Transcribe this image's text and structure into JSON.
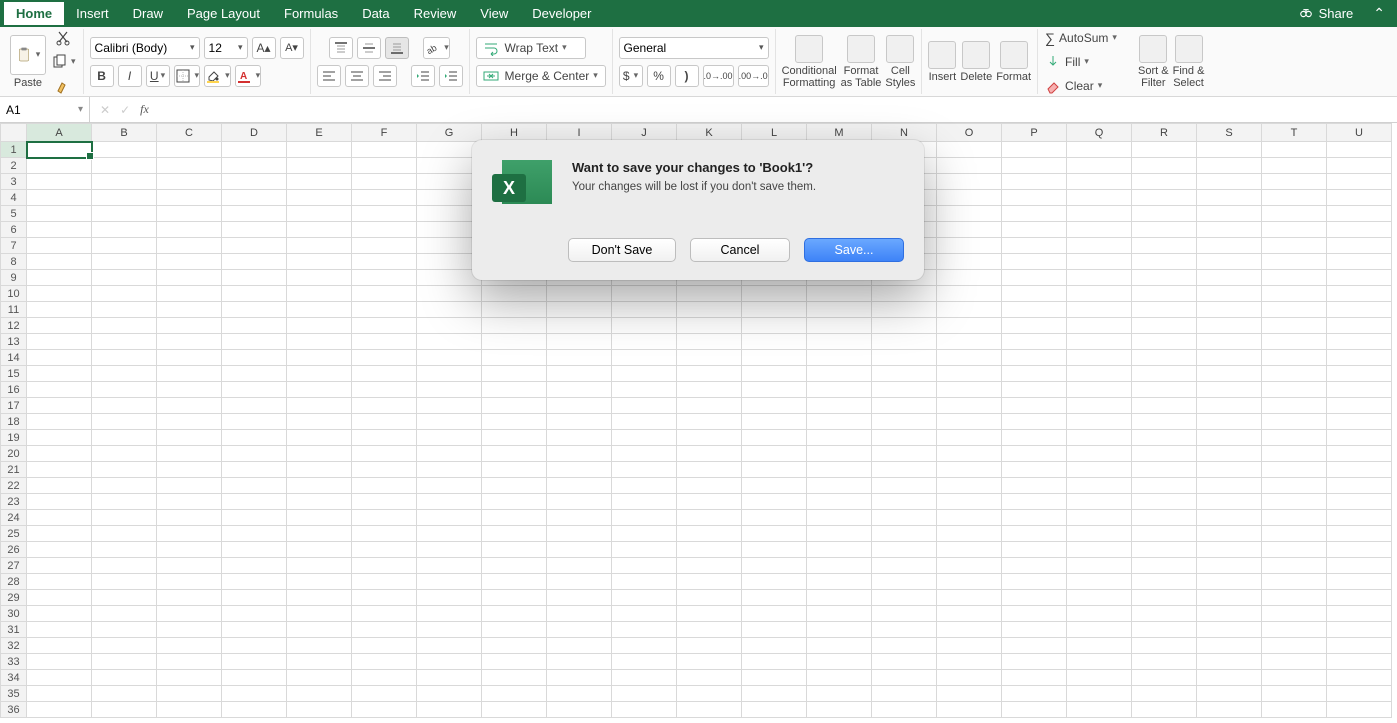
{
  "menubar": {
    "tabs": [
      "Home",
      "Insert",
      "Draw",
      "Page Layout",
      "Formulas",
      "Data",
      "Review",
      "View",
      "Developer"
    ],
    "active_index": 0,
    "share_label": "Share"
  },
  "ribbon": {
    "paste_label": "Paste",
    "font_name": "Calibri (Body)",
    "font_size": "12",
    "wrap_text_label": "Wrap Text",
    "merge_center_label": "Merge & Center",
    "number_format": "General",
    "conditional_formatting_label": "Conditional\nFormatting",
    "format_as_table_label": "Format\nas Table",
    "cell_styles_label": "Cell\nStyles",
    "insert_label": "Insert",
    "delete_label": "Delete",
    "format_label": "Format",
    "autosum_label": "AutoSum",
    "fill_label": "Fill",
    "clear_label": "Clear",
    "sort_filter_label": "Sort &\nFilter",
    "find_select_label": "Find &\nSelect"
  },
  "formula_bar": {
    "name_box": "A1",
    "formula": ""
  },
  "grid": {
    "columns": [
      "A",
      "B",
      "C",
      "D",
      "E",
      "F",
      "G",
      "H",
      "I",
      "J",
      "K",
      "L",
      "M",
      "N",
      "O",
      "P",
      "Q",
      "R",
      "S",
      "T",
      "U"
    ],
    "row_count": 36,
    "selected_cell": "A1"
  },
  "dialog": {
    "title": "Want to save your changes to 'Book1'?",
    "subtitle": "Your changes will be lost if you don't save them.",
    "buttons": {
      "dont_save": "Don't Save",
      "cancel": "Cancel",
      "save": "Save..."
    }
  }
}
